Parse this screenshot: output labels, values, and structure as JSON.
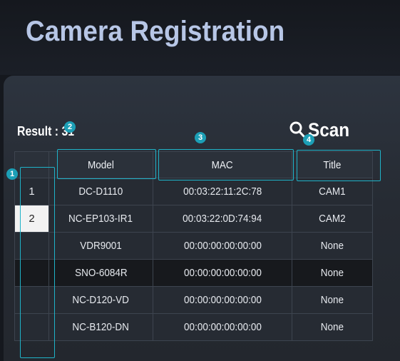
{
  "page": {
    "title": "Camera Registration"
  },
  "result": {
    "label": "Result : 31"
  },
  "scan": {
    "label": "Scan",
    "icon": "search-icon"
  },
  "table": {
    "headers": [
      "",
      "Model",
      "MAC",
      "Title"
    ],
    "rows": [
      {
        "index": "1",
        "model": "DC-D1110",
        "mac": "00:03:22:11:2C:78",
        "title": "CAM1"
      },
      {
        "index": "2",
        "model": "NC-EP103-IR1",
        "mac": "00:03:22:0D:74:94",
        "title": "CAM2"
      },
      {
        "index": "",
        "model": "VDR9001",
        "mac": "00:00:00:00:00:00",
        "title": "None"
      },
      {
        "index": "",
        "model": "SNO-6084R",
        "mac": "00:00:00:00:00:00",
        "title": "None"
      },
      {
        "index": "",
        "model": "NC-D120-VD",
        "mac": "00:00:00:00:00:00",
        "title": "None"
      },
      {
        "index": "",
        "model": "NC-B120-DN",
        "mac": "00:00:00:00:00:00",
        "title": "None"
      }
    ]
  },
  "markers": [
    "1",
    "2",
    "3",
    "4"
  ],
  "colors": {
    "accent": "#1c9fb6",
    "title_text": "#b7c6e6",
    "selected_cell": "#f2f2f2",
    "dark_row": "#17191d"
  }
}
